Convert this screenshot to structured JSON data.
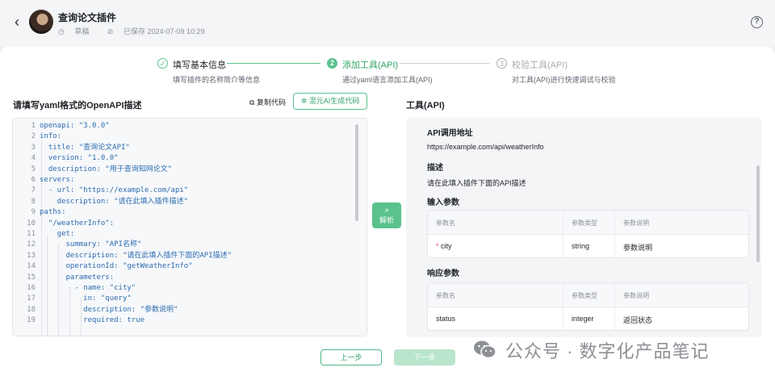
{
  "header": {
    "title": "查询论文插件",
    "status": "草稿",
    "saved": "已保存 2024-07-09 10:29",
    "help": "?"
  },
  "steps": [
    {
      "num": "✓",
      "title": "填写基本信息",
      "sub": "填写插件的名称简介等信息"
    },
    {
      "num": "2",
      "title": "添加工具(API)",
      "sub": "通过yaml语言添加工具(API)"
    },
    {
      "num": "3",
      "title": "校验工具(API)",
      "sub": "对工具(API)进行快速调试与校验"
    }
  ],
  "left": {
    "title": "请填写yaml格式的OpenAPI描述",
    "copy": "复制代码",
    "generate": "混元AI生成代码"
  },
  "code": [
    {
      "n": "1",
      "t": "openapi: \"3.0.0\""
    },
    {
      "n": "2",
      "t": "info:"
    },
    {
      "n": "3",
      "t": "  title: \"查询论文API\""
    },
    {
      "n": "4",
      "t": "  version: \"1.0.0\""
    },
    {
      "n": "5",
      "t": "  description: \"用于查询知网论文\""
    },
    {
      "n": "6",
      "t": "servers:"
    },
    {
      "n": "7",
      "t": "  - url: \"https://example.com/api\""
    },
    {
      "n": "8",
      "t": "    description: \"请在此填入插件描述\""
    },
    {
      "n": "9",
      "t": "paths:"
    },
    {
      "n": "10",
      "t": "  \"/weatherInfo\":"
    },
    {
      "n": "11",
      "t": "    get:"
    },
    {
      "n": "12",
      "t": "      summary: \"API名称\""
    },
    {
      "n": "13",
      "t": "      description: \"请在此填入插件下面的API描述\""
    },
    {
      "n": "14",
      "t": "      operationId: \"getWeatherInfo\""
    },
    {
      "n": "15",
      "t": "      parameters:"
    },
    {
      "n": "16",
      "t": "        - name: \"city\""
    },
    {
      "n": "17",
      "t": "          in: \"query\""
    },
    {
      "n": "18",
      "t": "          description: \"参数说明\""
    },
    {
      "n": "19",
      "t": "          required: true"
    }
  ],
  "parse": {
    "arrow": "»",
    "label": "解析"
  },
  "tool": {
    "title": "工具(API)",
    "url_h": "API调用地址",
    "url": "https://example.com/api/weatherInfo",
    "desc_h": "描述",
    "desc": "请在此填入插件下面的API描述",
    "in_h": "输入参数",
    "in_cols": [
      "参数名",
      "参数类型",
      "参数说明"
    ],
    "in_row": {
      "req": "*",
      "name": "city",
      "type": "string",
      "desc": "参数说明"
    },
    "out_h": "响应参数",
    "out_cols": [
      "参数名",
      "参数类型",
      "参数说明"
    ],
    "out_row": {
      "name": "status",
      "type": "integer",
      "desc": "返回状态"
    }
  },
  "footer": {
    "prev": "上一步",
    "next": "下一步"
  },
  "watermark": "公众号 · 数字化产品笔记",
  "colors": {
    "accent": "#5ac28c",
    "accent_dark": "#33a46a"
  }
}
